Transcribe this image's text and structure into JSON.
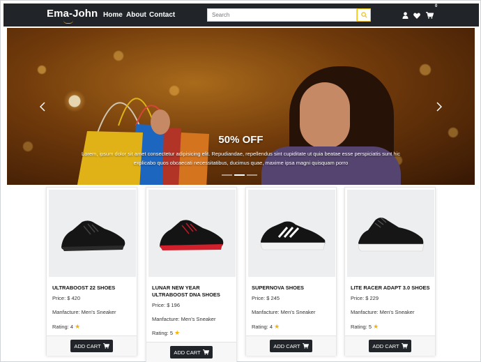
{
  "navbar": {
    "brand": "Ema-John",
    "links": [
      "Home",
      "About",
      "Contact"
    ],
    "search_placeholder": "Search",
    "cart_count": "0",
    "icons": [
      "search-icon",
      "user-icon",
      "heart-icon",
      "cart-icon"
    ]
  },
  "carousel": {
    "title": "50% OFF",
    "text": "Lorem, ipsum dolor sit amet consectetur adipisicing elit. Repudiandae, repellendus sint cupiditate ut quia beatae esse perspiciatis sunt hic explicabo quos obcaecati necessitatibus, ducimus quae, maxime ipsa magni quisquam porro",
    "slides": 3,
    "active_slide": 2
  },
  "products": [
    {
      "name": "ULTRABOOST 22 SHOES",
      "price": "Price: $ 420",
      "manufacturer": "Manfacture: Men's Sneaker",
      "rating": "Rating: 4",
      "button": "ADD CART"
    },
    {
      "name": "LUNAR NEW YEAR ULTRABOOST DNA SHOES",
      "price": "Price: $ 196",
      "manufacturer": "Manfacture: Men's Sneaker",
      "rating": "Rating: 5",
      "button": "ADD CART"
    },
    {
      "name": "SUPERNOVA SHOES",
      "price": "Price: $ 245",
      "manufacturer": "Manfacture: Men's Sneaker",
      "rating": "Rating: 4",
      "button": "ADD CART"
    },
    {
      "name": "LITE RACER ADAPT 3.0 SHOES",
      "price": "Price: $ 229",
      "manufacturer": "Manfacture: Men's Sneaker",
      "rating": "Rating: 5",
      "button": "ADD CART"
    }
  ],
  "colors": {
    "navbar": "#212529",
    "accent": "#f39c12",
    "star": "#f5b301"
  }
}
